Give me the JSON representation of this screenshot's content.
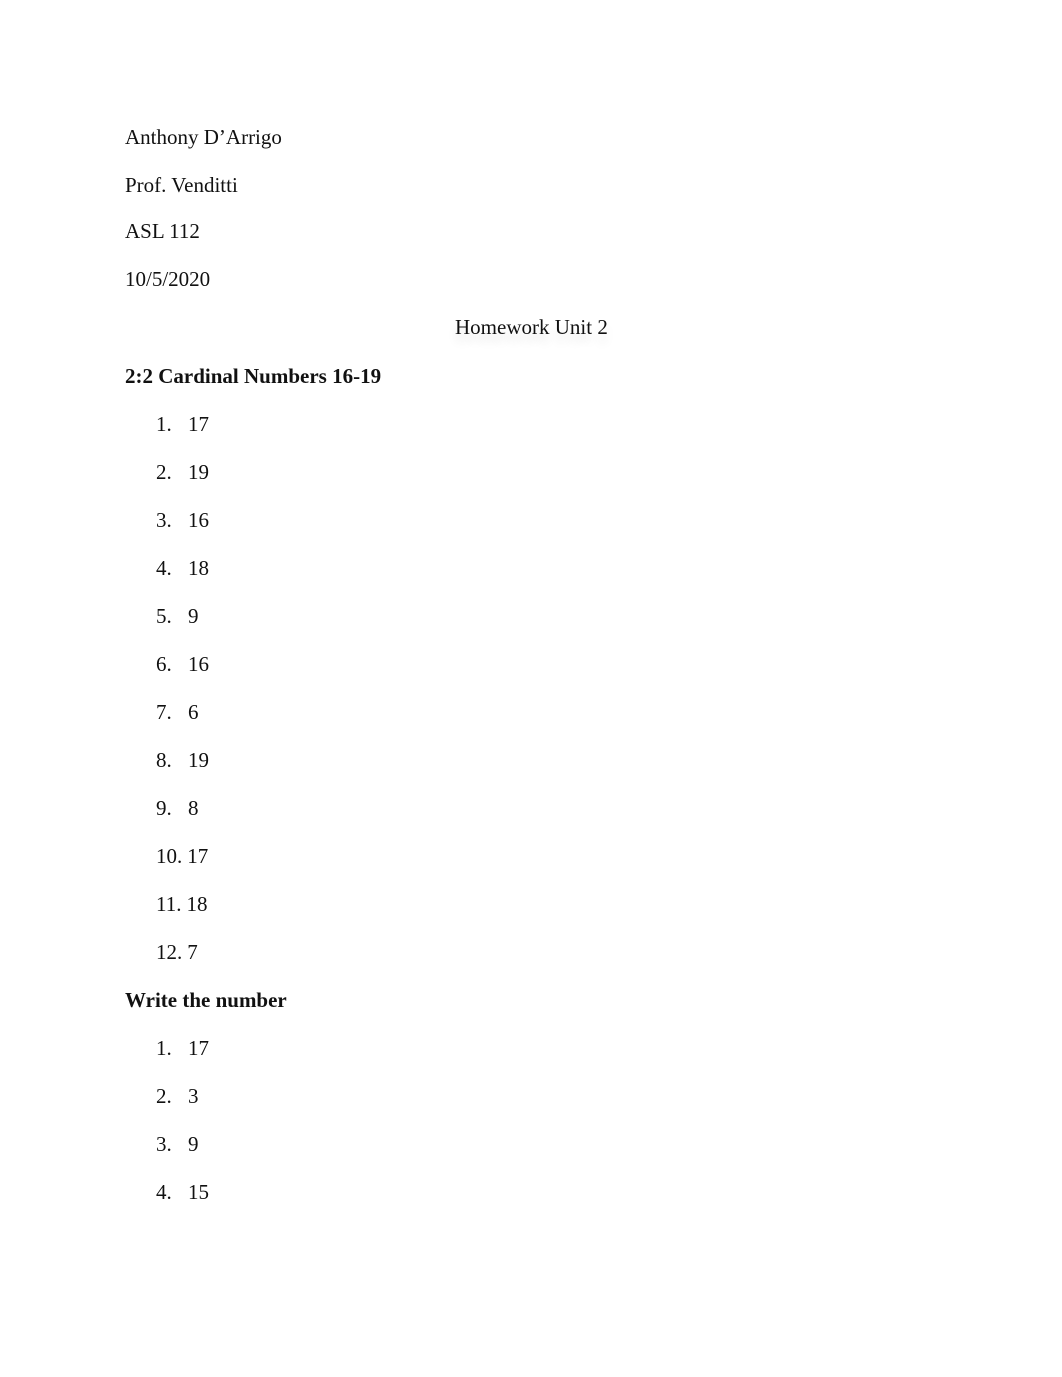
{
  "header": {
    "author": "Anthony D’Arrigo",
    "professor": "Prof. Venditti",
    "course": "ASL 112",
    "date": "10/5/2020"
  },
  "title": "Homework Unit 2",
  "sections": [
    {
      "heading": "2:2 Cardinal Numbers 16-19",
      "items": [
        {
          "n": "1.",
          "v": "17"
        },
        {
          "n": "2.",
          "v": "19"
        },
        {
          "n": "3.",
          "v": "16"
        },
        {
          "n": "4.",
          "v": "18"
        },
        {
          "n": "5.",
          "v": "9"
        },
        {
          "n": "6.",
          "v": "16"
        },
        {
          "n": "7.",
          "v": "6"
        },
        {
          "n": "8.",
          "v": "19"
        },
        {
          "n": "9.",
          "v": "8"
        },
        {
          "n": "10.",
          "v": "17"
        },
        {
          "n": "11.",
          "v": "18"
        },
        {
          "n": "12.",
          "v": "7"
        }
      ]
    },
    {
      "heading": "Write the number",
      "items": [
        {
          "n": "1.",
          "v": "17"
        },
        {
          "n": "2.",
          "v": "3"
        },
        {
          "n": "3.",
          "v": "9"
        },
        {
          "n": "4.",
          "v": "15"
        }
      ]
    }
  ]
}
